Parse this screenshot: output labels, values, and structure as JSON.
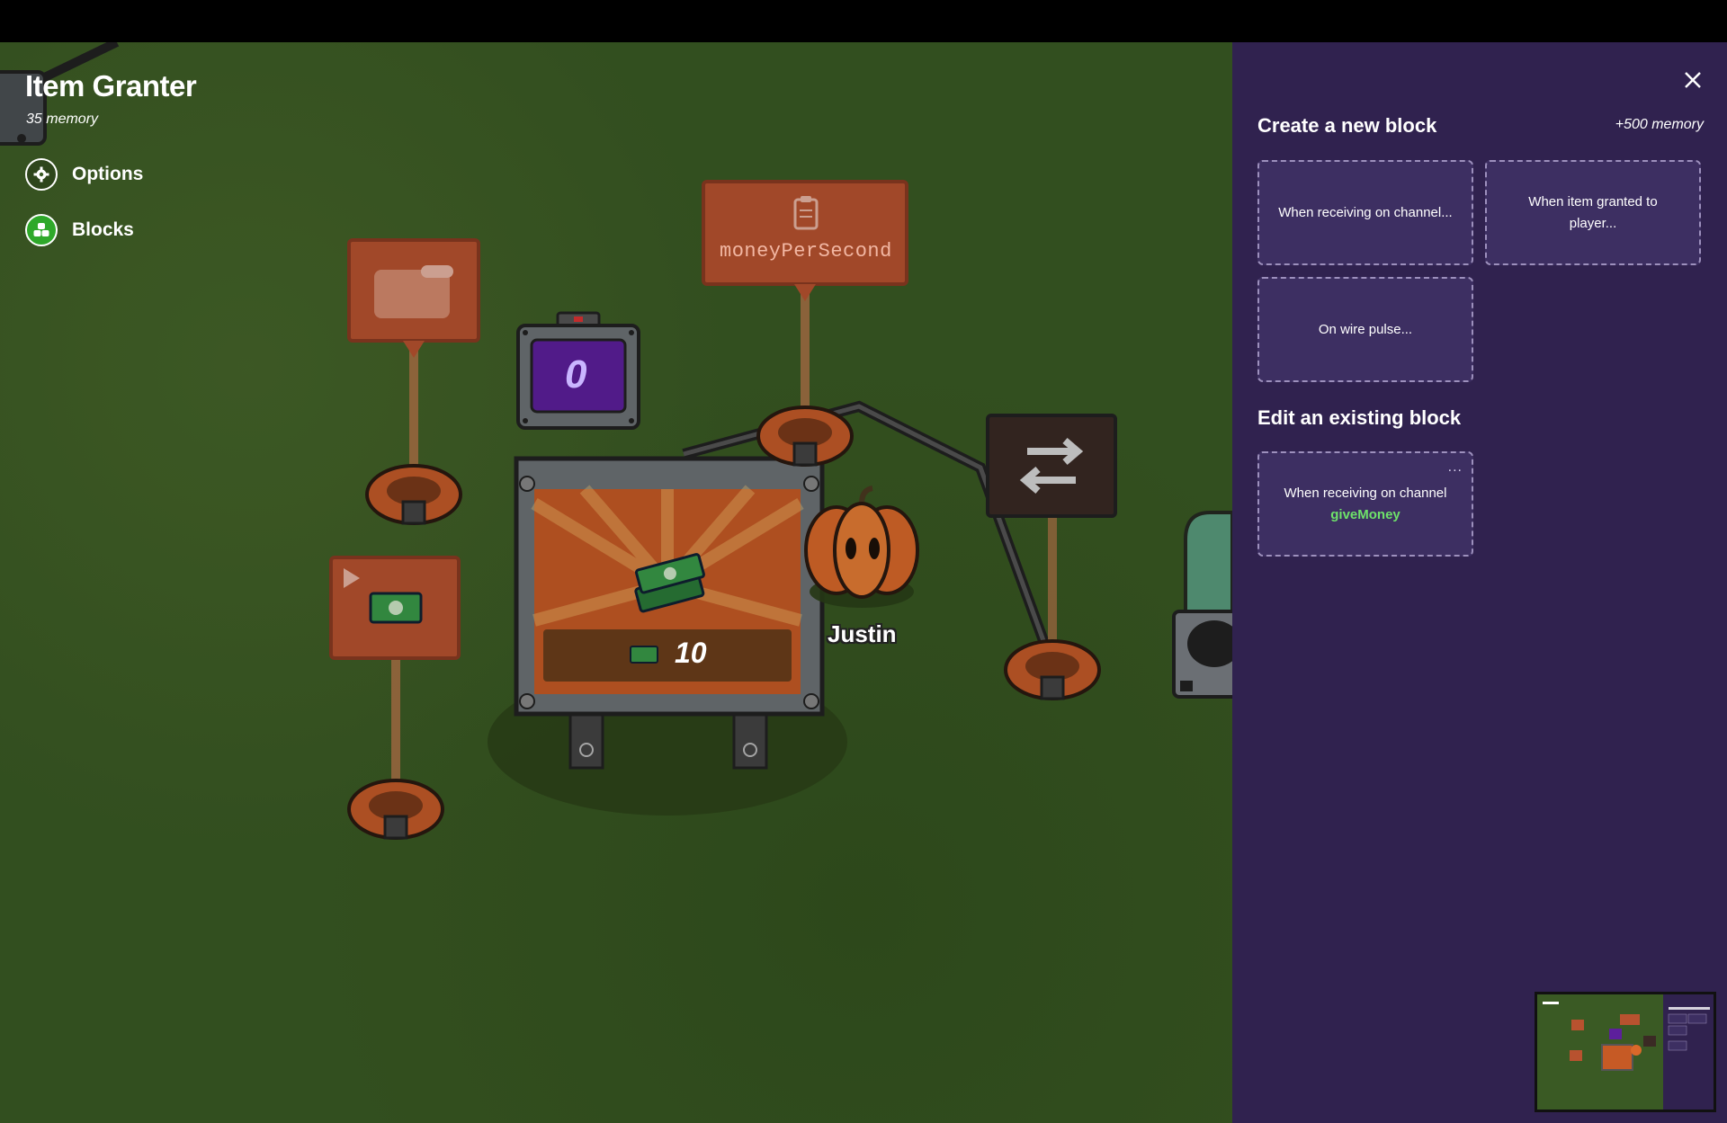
{
  "device": {
    "title": "Item Granter",
    "memory": "35 memory"
  },
  "menu": {
    "items": [
      {
        "label": "Options",
        "icon": "gear-icon"
      },
      {
        "label": "Blocks",
        "icon": "blocks-icon"
      }
    ]
  },
  "world": {
    "property_sign": "moneyPerSecond",
    "counter_value": "0",
    "item_box_count": "10",
    "player_name": "Justin"
  },
  "panel": {
    "create_title": "Create a new block",
    "create_memory": "+500 memory",
    "new_blocks": [
      "When receiving on channel...",
      "When item granted to player...",
      "On wire pulse..."
    ],
    "edit_title": "Edit an existing block",
    "existing_block": {
      "prefix": "When receiving on channel",
      "channel": "giveMoney",
      "menu_label": "..."
    }
  },
  "colors": {
    "panel_bg": "#30224f",
    "card_bg": "#3d2f62",
    "channel_green": "#6ee26a",
    "grass": "#3a5a24",
    "blocks_green": "#2fa82a"
  }
}
